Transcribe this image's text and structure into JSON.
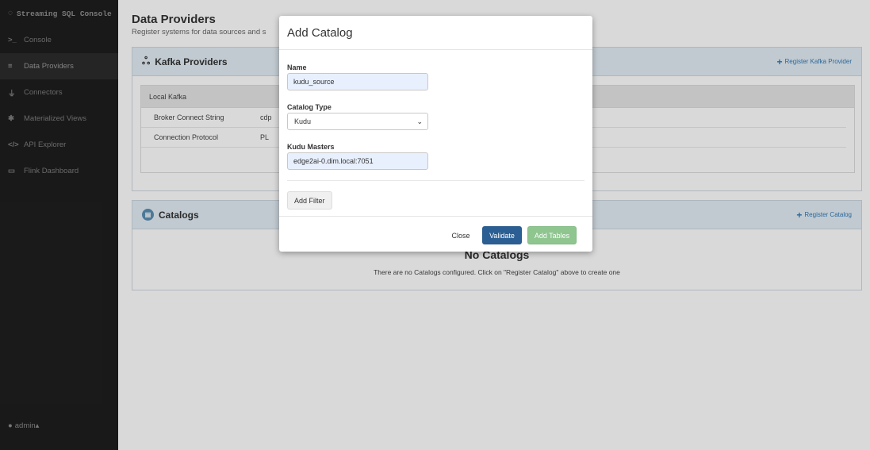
{
  "sidebar": {
    "brand": "Streaming SQL Console",
    "items": [
      {
        "icon": ">_",
        "label": "Console"
      },
      {
        "icon": "≡",
        "label": "Data Providers"
      },
      {
        "icon": "⏚",
        "label": "Connectors"
      },
      {
        "icon": "✱",
        "label": "Materialized Views"
      },
      {
        "icon": "</>",
        "label": "API Explorer"
      },
      {
        "icon": "▭",
        "label": "Flink Dashboard"
      }
    ],
    "user": "admin",
    "user_caret": "▴"
  },
  "main": {
    "title": "Data Providers",
    "subtitle": "Register systems for data sources and s"
  },
  "kafka": {
    "title": "Kafka Providers",
    "action": "Register Kafka Provider",
    "provider_name": "Local Kafka",
    "rows": [
      {
        "key": "Broker Connect String",
        "value": "cdp"
      },
      {
        "key": "Connection Protocol",
        "value": "PL"
      }
    ]
  },
  "catalogs": {
    "title": "Catalogs",
    "action": "Register Catalog",
    "empty_title": "No Catalogs",
    "empty_text": "There are no Catalogs configured. Click on \"Register Catalog\" above to create one"
  },
  "modal": {
    "title": "Add Catalog",
    "name_label": "Name",
    "name_value": "kudu_source",
    "type_label": "Catalog Type",
    "type_value": "Kudu",
    "masters_label": "Kudu Masters",
    "masters_value": "edge2ai-0.dim.local:7051",
    "add_filter": "Add Filter",
    "close": "Close",
    "validate": "Validate",
    "add_tables": "Add Tables"
  }
}
